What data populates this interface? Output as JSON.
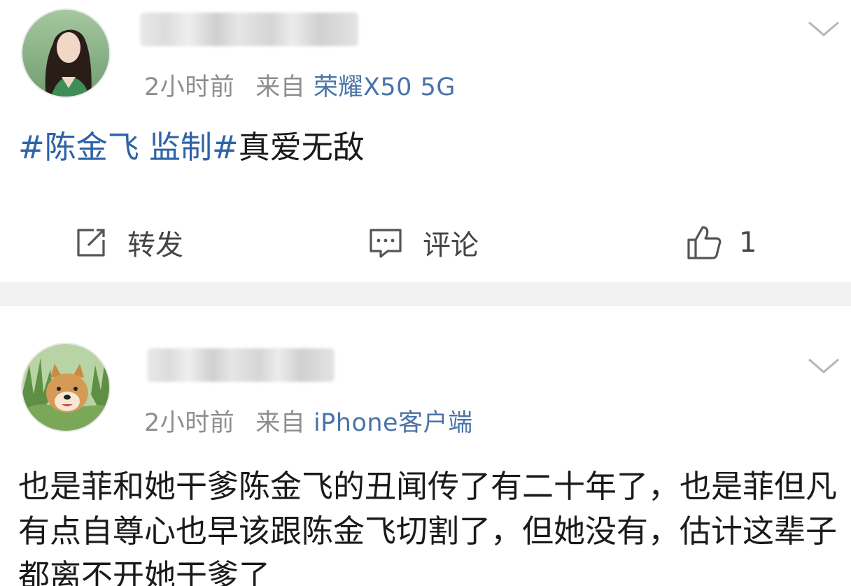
{
  "posts": [
    {
      "time": "2小时前",
      "from_label": "来自",
      "device": "荣耀X50 5G",
      "content_topic1": "#陈金飞 监制#",
      "content_text": "真爱无敌",
      "actions": {
        "repost_label": "转发",
        "comment_label": "评论",
        "like_count": "1"
      }
    },
    {
      "time": "2小时前",
      "from_label": "来自",
      "device": "iPhone客户端",
      "content_text": "也是菲和她干爹陈金飞的丑闻传了有二十年了，也是菲但凡有点自尊心也早该跟陈金飞切割了，但她没有，估计这辈子都离不开她干爹了"
    }
  ],
  "icons": {
    "repost": "edit-share-icon",
    "comment": "comment-bubble-icon",
    "like": "thumbs-up-icon",
    "menu": "chevron-down-icon"
  },
  "colors": {
    "topic": "#2d63a8",
    "meta": "#8e8e8e",
    "text": "#1a1a1a",
    "separator": "#f2f2f2"
  }
}
